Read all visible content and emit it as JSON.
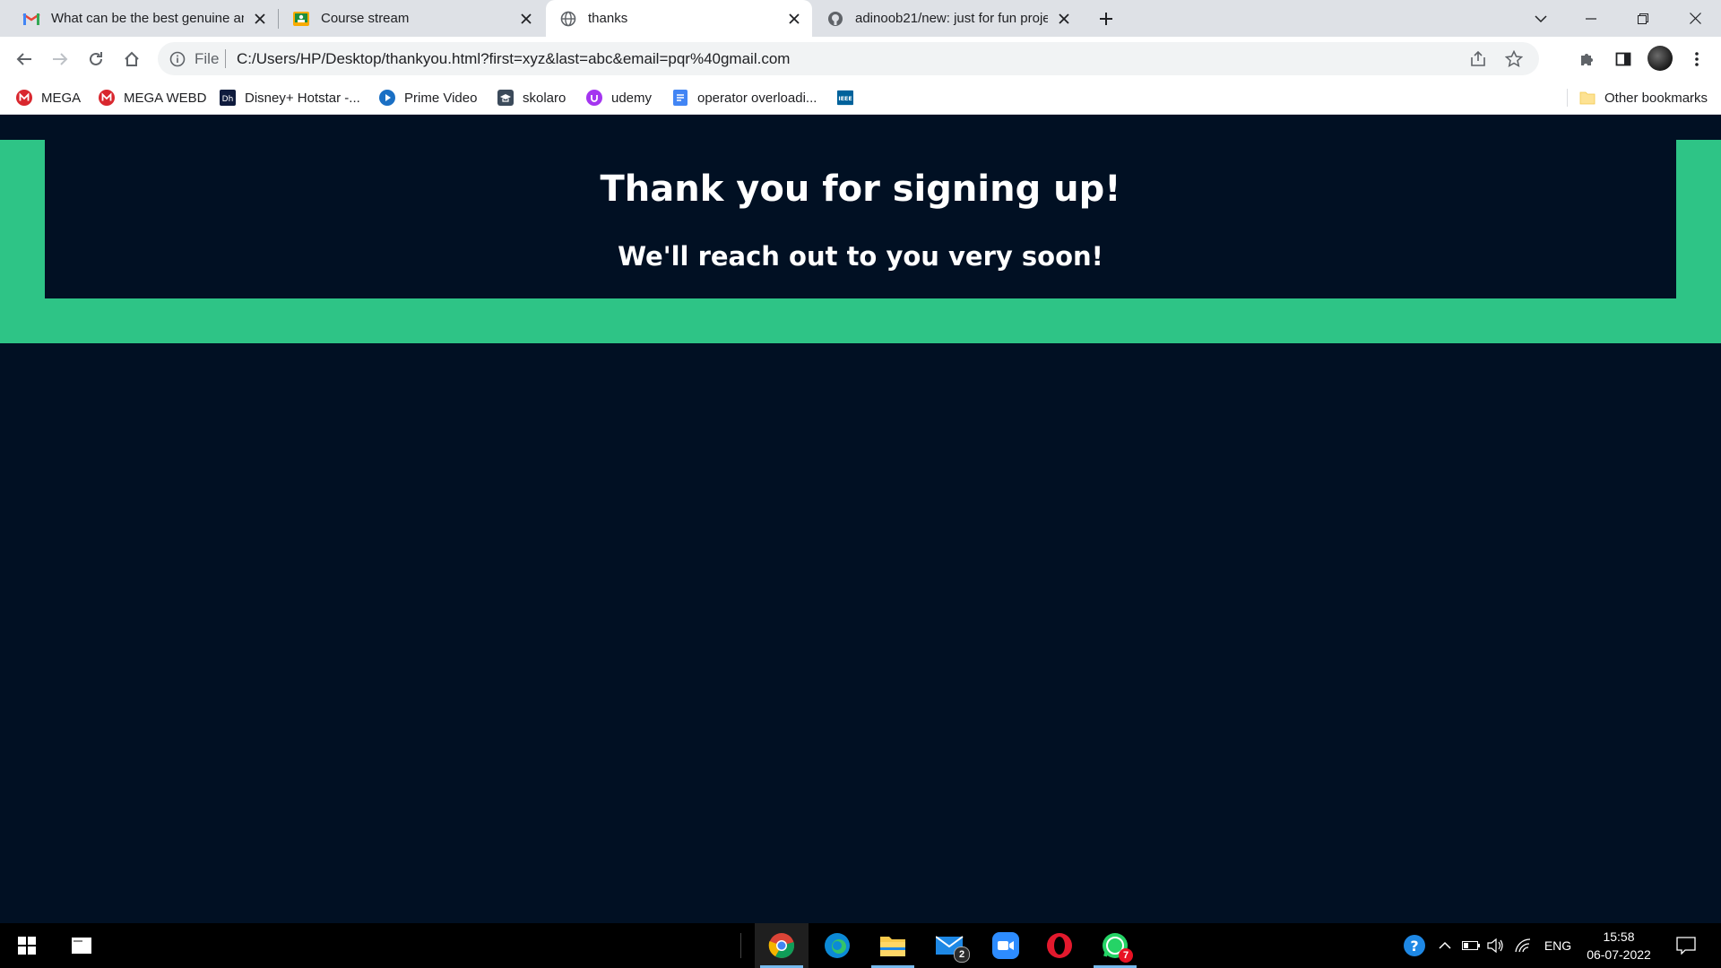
{
  "browser": {
    "tabs": [
      {
        "title": "What can be the best genuine an",
        "icon": "gmail-icon",
        "active": false
      },
      {
        "title": "Course stream",
        "icon": "google-classroom-icon",
        "active": false
      },
      {
        "title": "thanks",
        "icon": "globe-icon",
        "active": true
      },
      {
        "title": "adinoob21/new: just for fun proje",
        "icon": "github-icon",
        "active": false
      }
    ],
    "omnibox": {
      "scheme_label": "File",
      "url": "C:/Users/HP/Desktop/thankyou.html?first=xyz&last=abc&email=pqr%40gmail.com"
    },
    "bookmarks": [
      {
        "label": "MEGA",
        "icon": "mega-icon"
      },
      {
        "label": "MEGA WEBD",
        "icon": "mega-icon"
      },
      {
        "label": "Disney+ Hotstar -...",
        "icon": "hotstar-icon"
      },
      {
        "label": "Prime Video",
        "icon": "prime-video-icon"
      },
      {
        "label": "skolaro",
        "icon": "skolaro-icon"
      },
      {
        "label": "udemy",
        "icon": "udemy-icon"
      },
      {
        "label": "operator overloadi...",
        "icon": "docs-icon"
      },
      {
        "label": "",
        "icon": "ieee-icon"
      }
    ],
    "other_bookmarks": "Other bookmarks"
  },
  "page": {
    "heading": "Thank you for signing up!",
    "subheading": "We'll reach out to you very soon!",
    "colors": {
      "background": "#011023",
      "accent": "#2ec486",
      "text": "#ffffff"
    }
  },
  "taskbar": {
    "apps": [
      {
        "name": "chrome",
        "icon": "chrome-icon",
        "active": true
      },
      {
        "name": "edge",
        "icon": "edge-icon"
      },
      {
        "name": "file-explorer",
        "icon": "folder-icon",
        "active": true
      },
      {
        "name": "mail",
        "icon": "mail-icon",
        "badge": "2"
      },
      {
        "name": "zoom",
        "icon": "zoom-icon"
      },
      {
        "name": "opera",
        "icon": "opera-icon"
      },
      {
        "name": "whatsapp",
        "icon": "whatsapp-icon",
        "badge": "7",
        "active": true
      }
    ],
    "tray": {
      "language": "ENG",
      "time": "15:58",
      "date": "06-07-2022"
    }
  }
}
